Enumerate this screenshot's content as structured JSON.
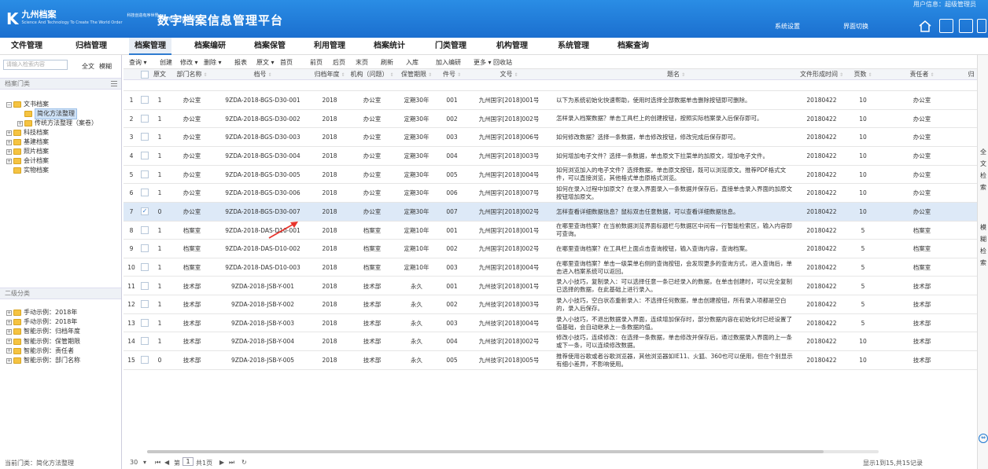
{
  "header": {
    "logo_brand": "九州档案",
    "logo_sub": "科技创造有序世界",
    "logo_tagline": "Science And Technology To Create The World Order",
    "edition": "K6.7 标准版",
    "title": "数字档案信息管理平台",
    "user": "用户信息：超级管理员",
    "links": [
      "系统设置",
      "界面切换"
    ],
    "icons": [
      "home-icon",
      "window-icon",
      "app-icon",
      "frame-icon"
    ]
  },
  "nav": {
    "items": [
      "文件管理",
      "归档管理",
      "档案管理",
      "档案编研",
      "档案保管",
      "利用管理",
      "档案统计",
      "门类管理",
      "机构管理",
      "系统管理",
      "档案查询"
    ],
    "active": 2
  },
  "left": {
    "search_placeholder": "请输入检索内容",
    "fulltext": "全文",
    "fuzzy": "模糊",
    "section1": "档案门类",
    "tree": [
      {
        "label": "文书档案",
        "level": 0,
        "pm": "−"
      },
      {
        "label": "简化方法整理",
        "level": 1,
        "pm": "",
        "selected": true
      },
      {
        "label": "传统方法整理（案卷）",
        "level": 1,
        "pm": "+"
      },
      {
        "label": "科技档案",
        "level": 0,
        "pm": "+"
      },
      {
        "label": "基建档案",
        "level": 0,
        "pm": "+"
      },
      {
        "label": "照片档案",
        "level": 0,
        "pm": "+"
      },
      {
        "label": "会计档案",
        "level": 0,
        "pm": "+"
      },
      {
        "label": "实物档案",
        "level": 0,
        "pm": ""
      }
    ],
    "section2": "二级分类",
    "tree2": [
      "手动示例：2018年",
      "手动示例：2018年",
      "智能示例：归档年度",
      "智能示例：保管期限",
      "智能示例：责任者",
      "智能示例：部门名称"
    ],
    "current_label": "当前门类：简化方法整理"
  },
  "toolbar": [
    "查询 ▾",
    "创建",
    "修改 ▾",
    "删除 ▾",
    "报表",
    "原文 ▾",
    "首页",
    "前页",
    "后页",
    "末页",
    "刷新",
    "入库",
    "加入编研",
    "更多 ▾",
    "回收站",
    "当前排序"
  ],
  "grid": {
    "headers": [
      "原文",
      "部门名称",
      "档号",
      "归档年度",
      "机构（问题）",
      "保管期限",
      "件号",
      "文号",
      "题名",
      "文件形成时间",
      "页数",
      "责任者",
      "归"
    ],
    "rows": [
      {
        "n": "1",
        "yw": "1",
        "bm": "办公室",
        "dh": "9ZDA-2018-BGS-D30-001",
        "nd": "2018",
        "jg": "办公室",
        "qx": "定期30年",
        "jh": "001",
        "wh": "九州国字[2018]001号",
        "tm": "以下为系统初始化快速帮助，使用时选择全部数据单击删除按钮即可删除。",
        "sj": "20180422",
        "ys": "10",
        "zr": "办公室"
      },
      {
        "n": "2",
        "yw": "1",
        "bm": "办公室",
        "dh": "9ZDA-2018-BGS-D30-002",
        "nd": "2018",
        "jg": "办公室",
        "qx": "定期30年",
        "jh": "002",
        "wh": "九州国字[2018]002号",
        "tm": "怎样录入档案数据？单击工具栏上的创建按钮，按照实际档案录入后保存即可。",
        "sj": "20180422",
        "ys": "10",
        "zr": "办公室"
      },
      {
        "n": "3",
        "yw": "1",
        "bm": "办公室",
        "dh": "9ZDA-2018-BGS-D30-003",
        "nd": "2018",
        "jg": "办公室",
        "qx": "定期30年",
        "jh": "003",
        "wh": "九州国字[2018]006号",
        "tm": "如何修改数据？选择一条数据，单击修改按钮，修改完成后保存即可。",
        "sj": "20180422",
        "ys": "10",
        "zr": "办公室"
      },
      {
        "n": "4",
        "yw": "1",
        "bm": "办公室",
        "dh": "9ZDA-2018-BGS-D30-004",
        "nd": "2018",
        "jg": "办公室",
        "qx": "定期30年",
        "jh": "004",
        "wh": "九州国字[2018]003号",
        "tm": "如何增加电子文件？选择一条数据，单击原文下拉菜单的加原文，增加电子文件。",
        "sj": "20180422",
        "ys": "10",
        "zr": "办公室"
      },
      {
        "n": "5",
        "yw": "1",
        "bm": "办公室",
        "dh": "9ZDA-2018-BGS-D30-005",
        "nd": "2018",
        "jg": "办公室",
        "qx": "定期30年",
        "jh": "005",
        "wh": "九州国字[2018]004号",
        "tm": "如何浏览加入的电子文件？选择数据，单击原文按钮，既可以浏览原文。推荐PDF格式文件，可以直接浏览，其他格式单击原格式浏览。",
        "sj": "20180422",
        "ys": "10",
        "zr": "办公室"
      },
      {
        "n": "6",
        "yw": "1",
        "bm": "办公室",
        "dh": "9ZDA-2018-BGS-D30-006",
        "nd": "2018",
        "jg": "办公室",
        "qx": "定期30年",
        "jh": "006",
        "wh": "九州国字[2018]007号",
        "tm": "如何在录入过程中加原文？在录入界面录入一条数据并保存后，直接单击录入界面的加原文按钮增加原文。",
        "sj": "20180422",
        "ys": "10",
        "zr": "办公室"
      },
      {
        "n": "7",
        "yw": "0",
        "bm": "办公室",
        "dh": "9ZDA-2018-BGS-D30-007",
        "nd": "2018",
        "jg": "办公室",
        "qx": "定期30年",
        "jh": "007",
        "wh": "九州国字[2018]002号",
        "tm": "怎样查看详细数据信息？鼠标双击任意数据，可以查看详细数据信息。",
        "sj": "20180422",
        "ys": "10",
        "zr": "办公室",
        "sel": true
      },
      {
        "n": "8",
        "yw": "1",
        "bm": "档案室",
        "dh": "9ZDA-2018-DAS-D10-001",
        "nd": "2018",
        "jg": "档案室",
        "qx": "定期10年",
        "jh": "001",
        "wh": "九州国字[2018]001号",
        "tm": "在哪里查询档案？在当前数据浏览界面标题栏与数据区中间有一行智能检索区，输入内容即可查询。",
        "sj": "20180422",
        "ys": "5",
        "zr": "档案室"
      },
      {
        "n": "9",
        "yw": "1",
        "bm": "档案室",
        "dh": "9ZDA-2018-DAS-D10-002",
        "nd": "2018",
        "jg": "档案室",
        "qx": "定期10年",
        "jh": "002",
        "wh": "九州国字[2018]002号",
        "tm": "在哪里查询档案？在工具栏上面点击查询按钮，输入查询内容，查询档案。",
        "sj": "20180422",
        "ys": "5",
        "zr": "档案室"
      },
      {
        "n": "10",
        "yw": "1",
        "bm": "档案室",
        "dh": "9ZDA-2018-DAS-D10-003",
        "nd": "2018",
        "jg": "档案室",
        "qx": "定期10年",
        "jh": "003",
        "wh": "九州国字[2018]004号",
        "tm": "在哪里查询档案？单击一级菜单右侧的查询按钮，会发现更多的查询方式，进入查询后，单击进入档案系统可以返回。",
        "sj": "20180422",
        "ys": "5",
        "zr": "档案室"
      },
      {
        "n": "11",
        "yw": "1",
        "bm": "技术部",
        "dh": "9ZDA-2018-JSB-Y-001",
        "nd": "2018",
        "jg": "技术部",
        "qx": "永久",
        "jh": "001",
        "wh": "九州技字[2018]001号",
        "tm": "录入小技巧，复制录入：可以选择任意一条已经录入的数据，在单击创建时，可以完全复制已选择的数据，在此基础上进行录入。",
        "sj": "20180422",
        "ys": "5",
        "zr": "技术部"
      },
      {
        "n": "12",
        "yw": "1",
        "bm": "技术部",
        "dh": "9ZDA-2018-JSB-Y-002",
        "nd": "2018",
        "jg": "技术部",
        "qx": "永久",
        "jh": "002",
        "wh": "九州技字[2018]003号",
        "tm": "录入小技巧，空白状态重新录入：不选择任何数据，单击创建按钮，所有录入项都是空白的，录入后保存。",
        "sj": "20180422",
        "ys": "5",
        "zr": "技术部"
      },
      {
        "n": "13",
        "yw": "1",
        "bm": "技术部",
        "dh": "9ZDA-2018-JSB-Y-003",
        "nd": "2018",
        "jg": "技术部",
        "qx": "永久",
        "jh": "003",
        "wh": "九州技字[2018]004号",
        "tm": "录入小技巧，不退出数据录入界面，连续增加保存时，部分数据内容在初始化时已经设置了值基础，会自动继承上一条数据的值。",
        "sj": "20180422",
        "ys": "5",
        "zr": "技术部"
      },
      {
        "n": "14",
        "yw": "1",
        "bm": "技术部",
        "dh": "9ZDA-2018-JSB-Y-004",
        "nd": "2018",
        "jg": "技术部",
        "qx": "永久",
        "jh": "004",
        "wh": "九州技字[2018]002号",
        "tm": "修改小技巧，连续修改：在选择一条数据，单击修改并保存后，通过数据录入界面的上一条或下一条，可以连续修改数据。",
        "sj": "20180422",
        "ys": "10",
        "zr": "技术部"
      },
      {
        "n": "15",
        "yw": "0",
        "bm": "技术部",
        "dh": "9ZDA-2018-JSB-Y-005",
        "nd": "2018",
        "jg": "技术部",
        "qx": "永久",
        "jh": "005",
        "wh": "九州技字[2018]005号",
        "tm": "推荐使用谷歌或者谷歌浏览器，其他浏览器如IE11、火狐、360也可以使用，但在个别显示有细小差异，不影响使用。",
        "sj": "20180422",
        "ys": "10",
        "zr": "技术部"
      }
    ]
  },
  "right_strip": {
    "top": [
      "全",
      "文",
      "检",
      "索"
    ],
    "bottom": [
      "模",
      "糊",
      "检",
      "索"
    ]
  },
  "footer": {
    "page_size": "30",
    "page_label": "第",
    "page_value": "1",
    "page_total": "共1页",
    "summary": "显示1到15,共15记录"
  }
}
